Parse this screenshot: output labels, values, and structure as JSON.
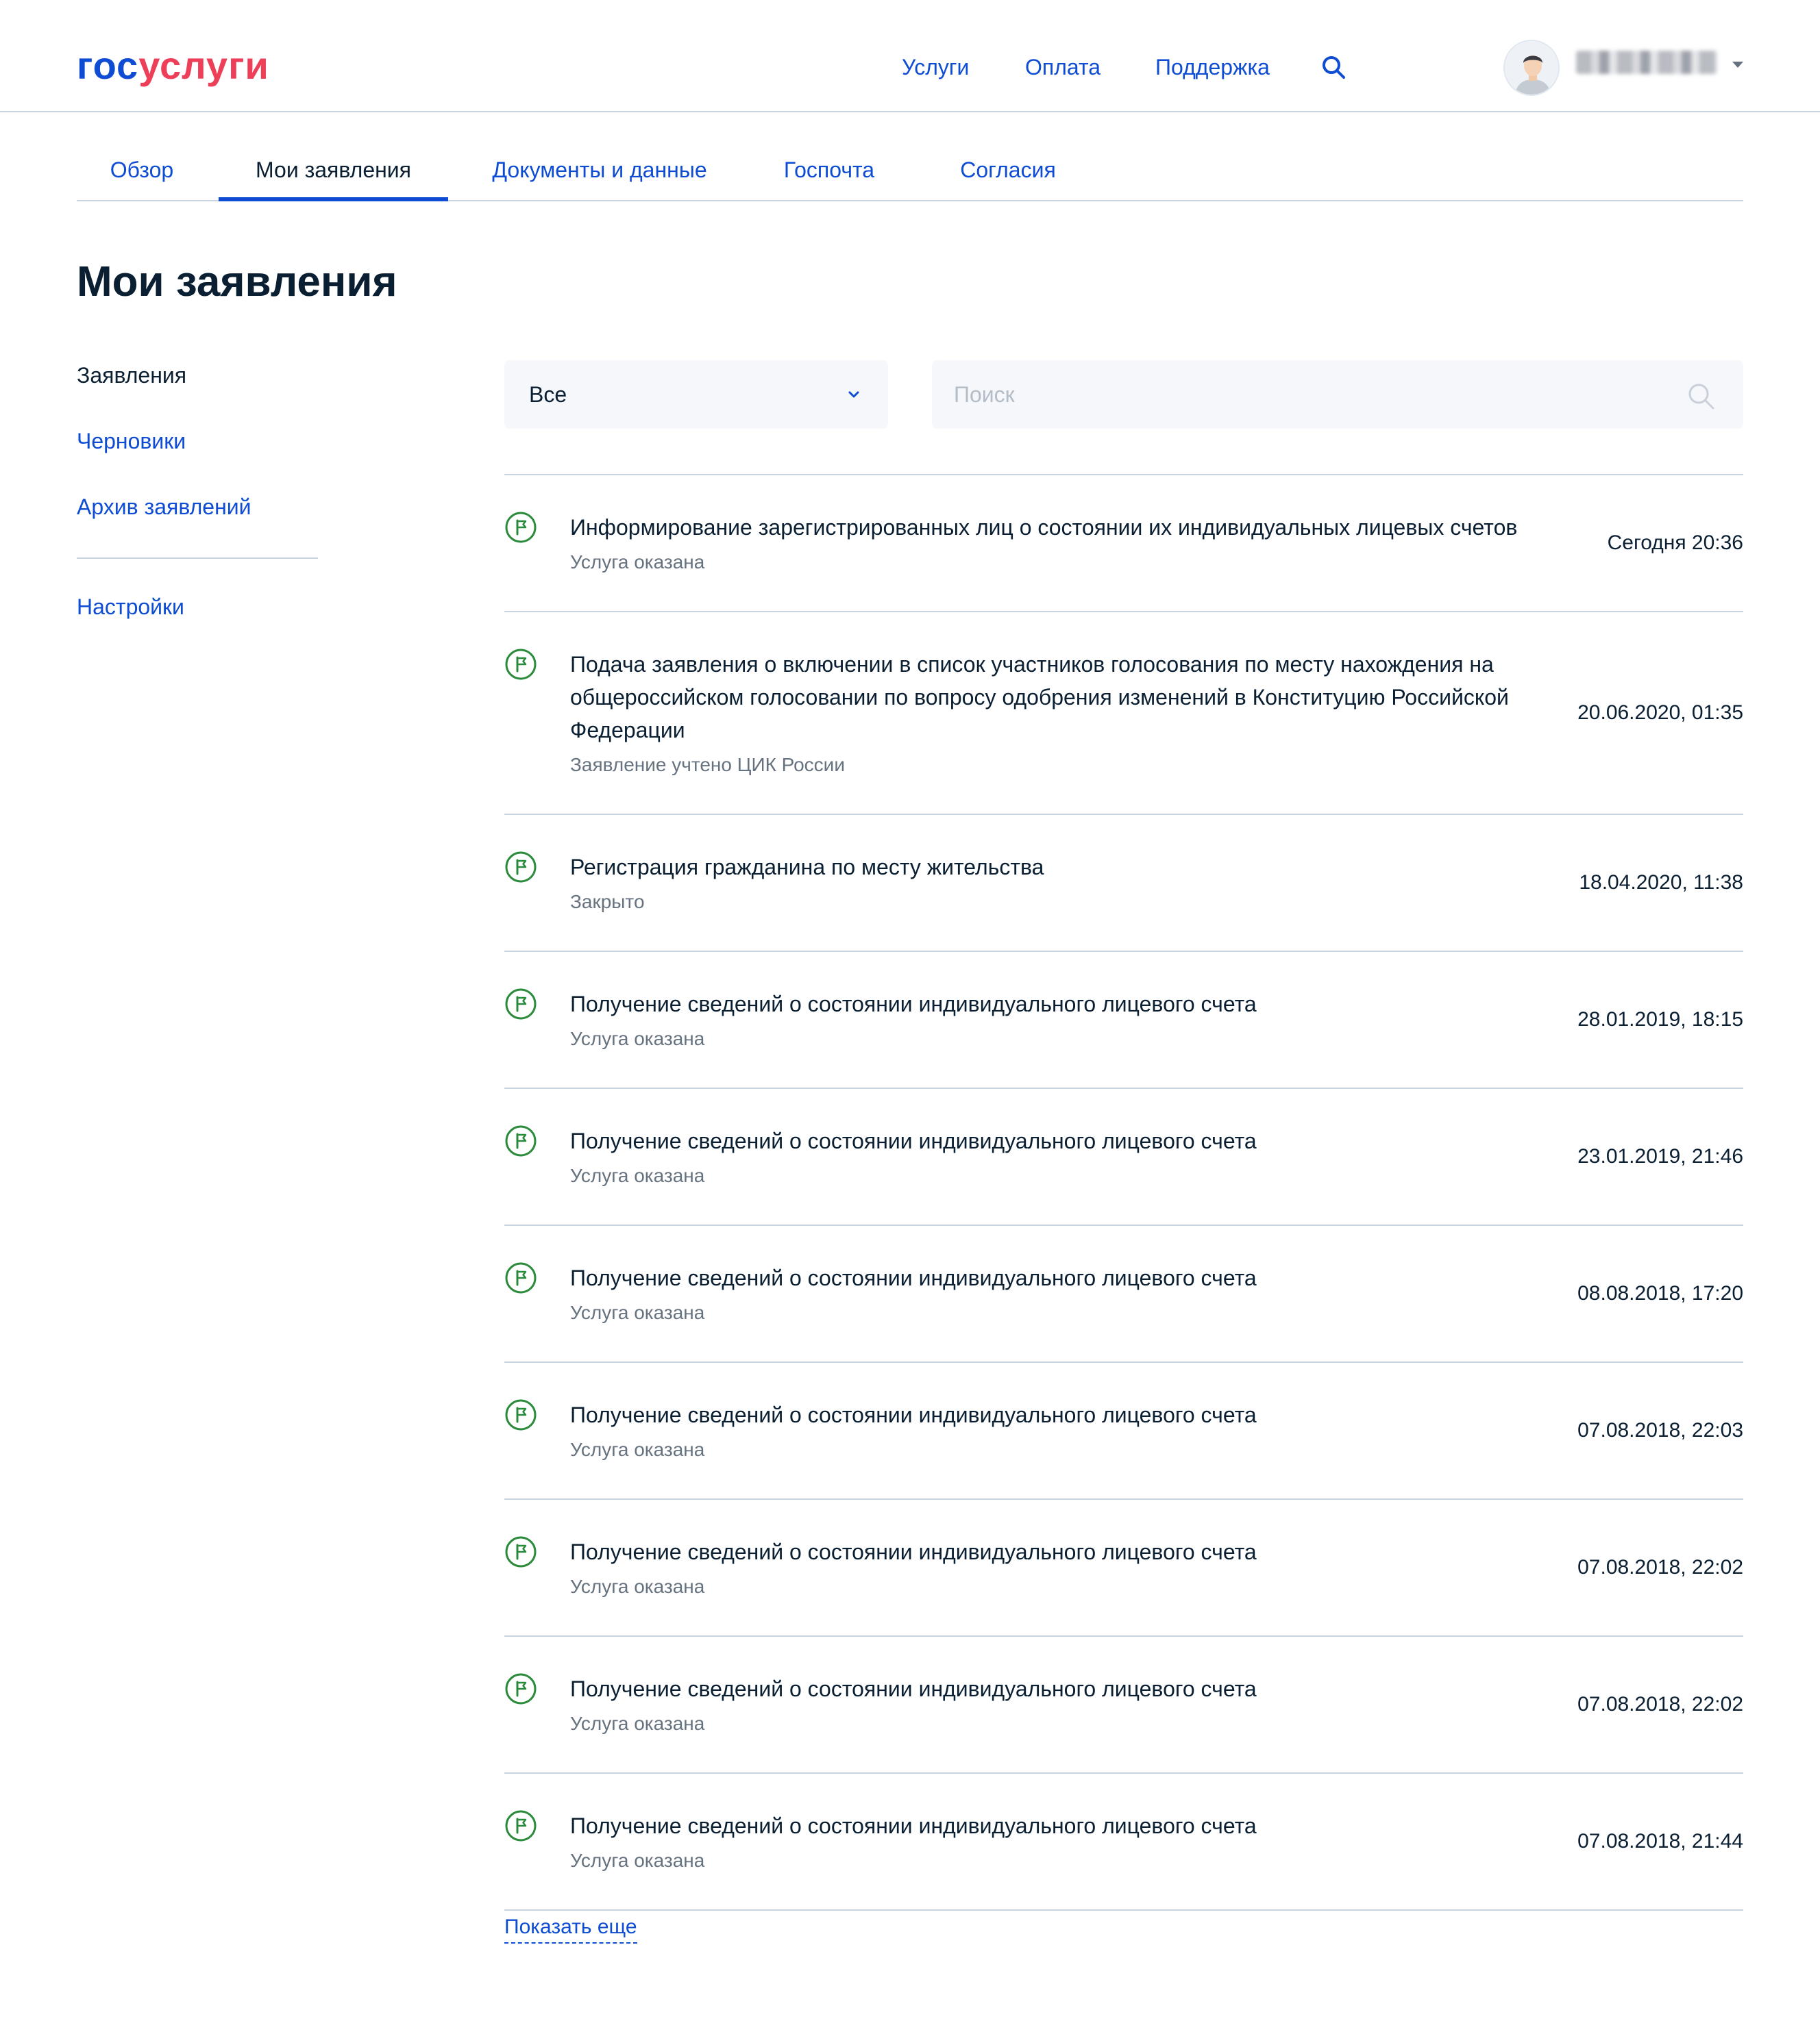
{
  "header": {
    "logo_gos": "гос",
    "logo_uslugi": "услуги",
    "nav": [
      "Услуги",
      "Оплата",
      "Поддержка"
    ],
    "search_icon": "search-icon",
    "username": "████████ ██",
    "user_menu_icon": "caret-down-icon"
  },
  "tabs": [
    {
      "label": "Обзор",
      "active": false
    },
    {
      "label": "Мои заявления",
      "active": true
    },
    {
      "label": "Документы и данные",
      "active": false
    },
    {
      "label": "Госпочта",
      "active": false
    },
    {
      "label": "Согласия",
      "active": false
    }
  ],
  "page_title": "Мои заявления",
  "sidebar": {
    "items": [
      "Заявления",
      "Черновики",
      "Архив заявлений",
      "Настройки"
    ],
    "current": "Заявления"
  },
  "filters": {
    "select_value": "Все",
    "search_placeholder": "Поиск",
    "search_value": ""
  },
  "applications": [
    {
      "title": "Информирование зарегистрированных лиц о состоянии их индивидуальных лицевых счетов",
      "status": "Услуга оказана",
      "date": "Сегодня 20:36"
    },
    {
      "title": "Подача заявления о включении в список участников голосования по месту нахождения на общероссийском голосовании по вопросу одобрения изменений в Конституцию Российской Федерации",
      "status": "Заявление учтено ЦИК России",
      "date": "20.06.2020, 01:35"
    },
    {
      "title": "Регистрация гражданина по месту жительства",
      "status": "Закрыто",
      "date": "18.04.2020, 11:38"
    },
    {
      "title": "Получение сведений о состоянии индивидуального лицевого счета",
      "status": "Услуга оказана",
      "date": "28.01.2019, 18:15"
    },
    {
      "title": "Получение сведений о состоянии индивидуального лицевого счета",
      "status": "Услуга оказана",
      "date": "23.01.2019, 21:46"
    },
    {
      "title": "Получение сведений о состоянии индивидуального лицевого счета",
      "status": "Услуга оказана",
      "date": "08.08.2018, 17:20"
    },
    {
      "title": "Получение сведений о состоянии индивидуального лицевого счета",
      "status": "Услуга оказана",
      "date": "07.08.2018, 22:03"
    },
    {
      "title": "Получение сведений о состоянии индивидуального лицевого счета",
      "status": "Услуга оказана",
      "date": "07.08.2018, 22:02"
    },
    {
      "title": "Получение сведений о состоянии индивидуального лицевого счета",
      "status": "Услуга оказана",
      "date": "07.08.2018, 22:02"
    },
    {
      "title": "Получение сведений о состоянии индивидуального лицевого счета",
      "status": "Услуга оказана",
      "date": "07.08.2018, 21:44"
    }
  ],
  "show_more": "Показать еще",
  "colors": {
    "brand_blue": "#0d4cd3",
    "brand_red": "#ee3f58",
    "status_green": "#2a8b3c",
    "divider": "#c9d3e0",
    "muted_text": "#66727f"
  }
}
